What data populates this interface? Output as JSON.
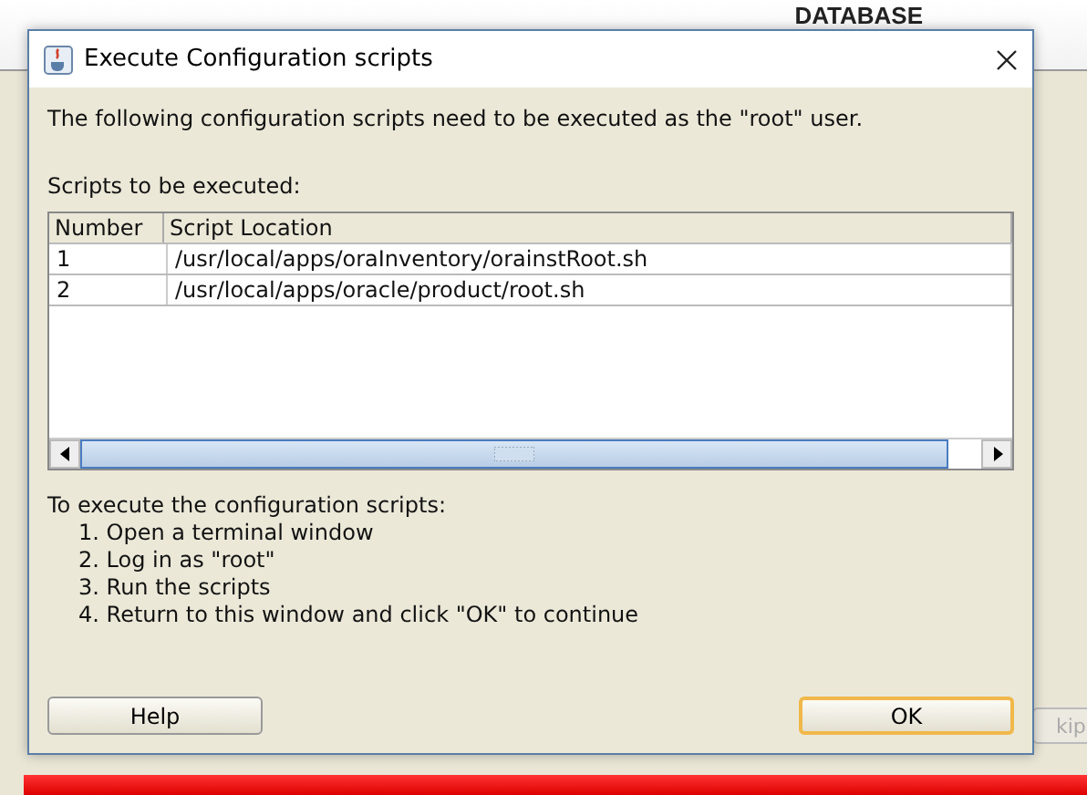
{
  "background": {
    "brand_text": "DATABASE",
    "skip_button": "kip"
  },
  "dialog": {
    "title": "Execute Configuration scripts",
    "message": "The following configuration scripts need to be executed as the \"root\" user.",
    "table_label": "Scripts to be executed:",
    "table": {
      "columns": [
        "Number",
        "Script Location"
      ],
      "rows": [
        {
          "number": "1",
          "location": "/usr/local/apps/oraInventory/orainstRoot.sh"
        },
        {
          "number": "2",
          "location": "/usr/local/apps/oracle/product/root.sh"
        }
      ]
    },
    "instructions_title": "To execute the configuration scripts:",
    "steps": [
      "1. Open a terminal window",
      "2. Log in as \"root\"",
      "3. Run the scripts",
      "4. Return to this window and click \"OK\" to continue"
    ],
    "buttons": [
      {
        "label": "Help",
        "default": false
      },
      {
        "label": "OK",
        "default": true
      }
    ]
  }
}
